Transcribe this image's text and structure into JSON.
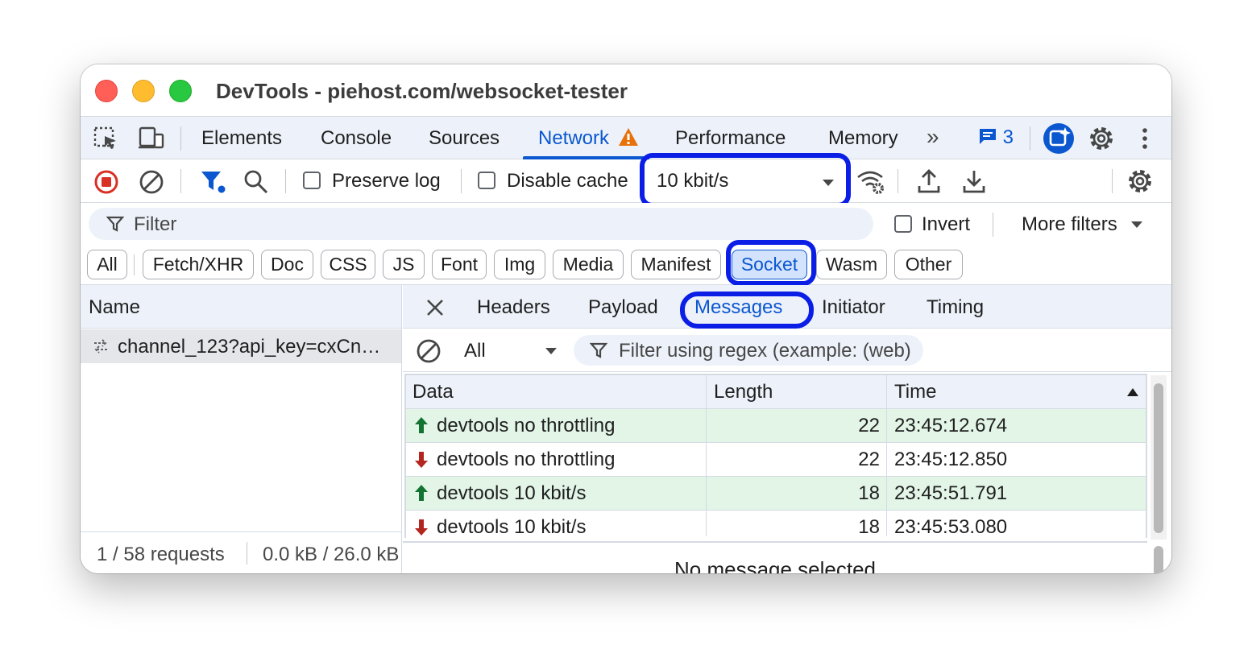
{
  "window": {
    "title": "DevTools - piehost.com/websocket-tester"
  },
  "panel_tabs": {
    "items": [
      "Elements",
      "Console",
      "Sources",
      "Network",
      "Performance",
      "Memory"
    ],
    "active": "Network",
    "issues_count": "3"
  },
  "toolbar": {
    "preserve_log": "Preserve log",
    "disable_cache": "Disable cache",
    "throttling": "10 kbit/s"
  },
  "filterbar": {
    "placeholder": "Filter",
    "invert": "Invert",
    "more_filters": "More filters"
  },
  "type_filters": {
    "items": [
      "All",
      "Fetch/XHR",
      "Doc",
      "CSS",
      "JS",
      "Font",
      "Img",
      "Media",
      "Manifest",
      "Socket",
      "Wasm",
      "Other"
    ],
    "active": "Socket"
  },
  "requests": {
    "header": "Name",
    "rows": [
      {
        "name": "channel_123?api_key=cxCn…"
      }
    ]
  },
  "status": {
    "requests": "1 / 58 requests",
    "transferred": "0.0 kB / 26.0 kB"
  },
  "detail_tabs": {
    "items": [
      "Headers",
      "Payload",
      "Messages",
      "Initiator",
      "Timing"
    ],
    "active": "Messages"
  },
  "messages": {
    "filter_select": "All",
    "regex_placeholder": "Filter using regex (example: (web)",
    "columns": {
      "data": "Data",
      "length": "Length",
      "time": "Time"
    },
    "rows": [
      {
        "direction": "sent",
        "data": "devtools no throttling",
        "length": "22",
        "time": "23:45:12.674"
      },
      {
        "direction": "received",
        "data": "devtools no throttling",
        "length": "22",
        "time": "23:45:12.850"
      },
      {
        "direction": "sent",
        "data": "devtools 10 kbit/s",
        "length": "18",
        "time": "23:45:51.791"
      },
      {
        "direction": "received",
        "data": "devtools 10 kbit/s",
        "length": "18",
        "time": "23:45:53.080"
      }
    ],
    "empty_state": "No message selected"
  },
  "colors": {
    "accent": "#0b57d0",
    "highlight": "#0a1ee6",
    "sent_row": "#e2f5e7",
    "sent_arrow": "#137333",
    "received_arrow": "#b3261e",
    "warning": "#e8710a",
    "record": "#d93025"
  }
}
